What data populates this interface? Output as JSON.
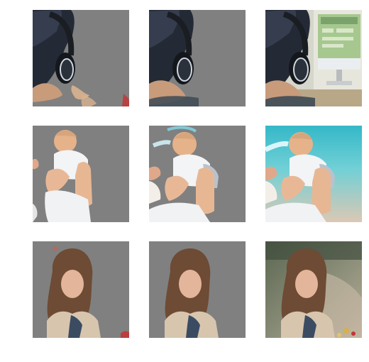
{
  "figure": {
    "rows": [
      {
        "name": "headphones-person",
        "tiles": [
          {
            "variant": "masked-coarse"
          },
          {
            "variant": "masked-refined"
          },
          {
            "variant": "original"
          }
        ]
      },
      {
        "name": "baby-lift",
        "tiles": [
          {
            "variant": "masked-coarse"
          },
          {
            "variant": "masked-refined"
          },
          {
            "variant": "original"
          }
        ]
      },
      {
        "name": "woman-portrait",
        "tiles": [
          {
            "variant": "masked-coarse"
          },
          {
            "variant": "masked-refined"
          },
          {
            "variant": "original"
          }
        ]
      }
    ],
    "colors": {
      "mask_gray": "#808080",
      "background": "#ffffff"
    }
  }
}
